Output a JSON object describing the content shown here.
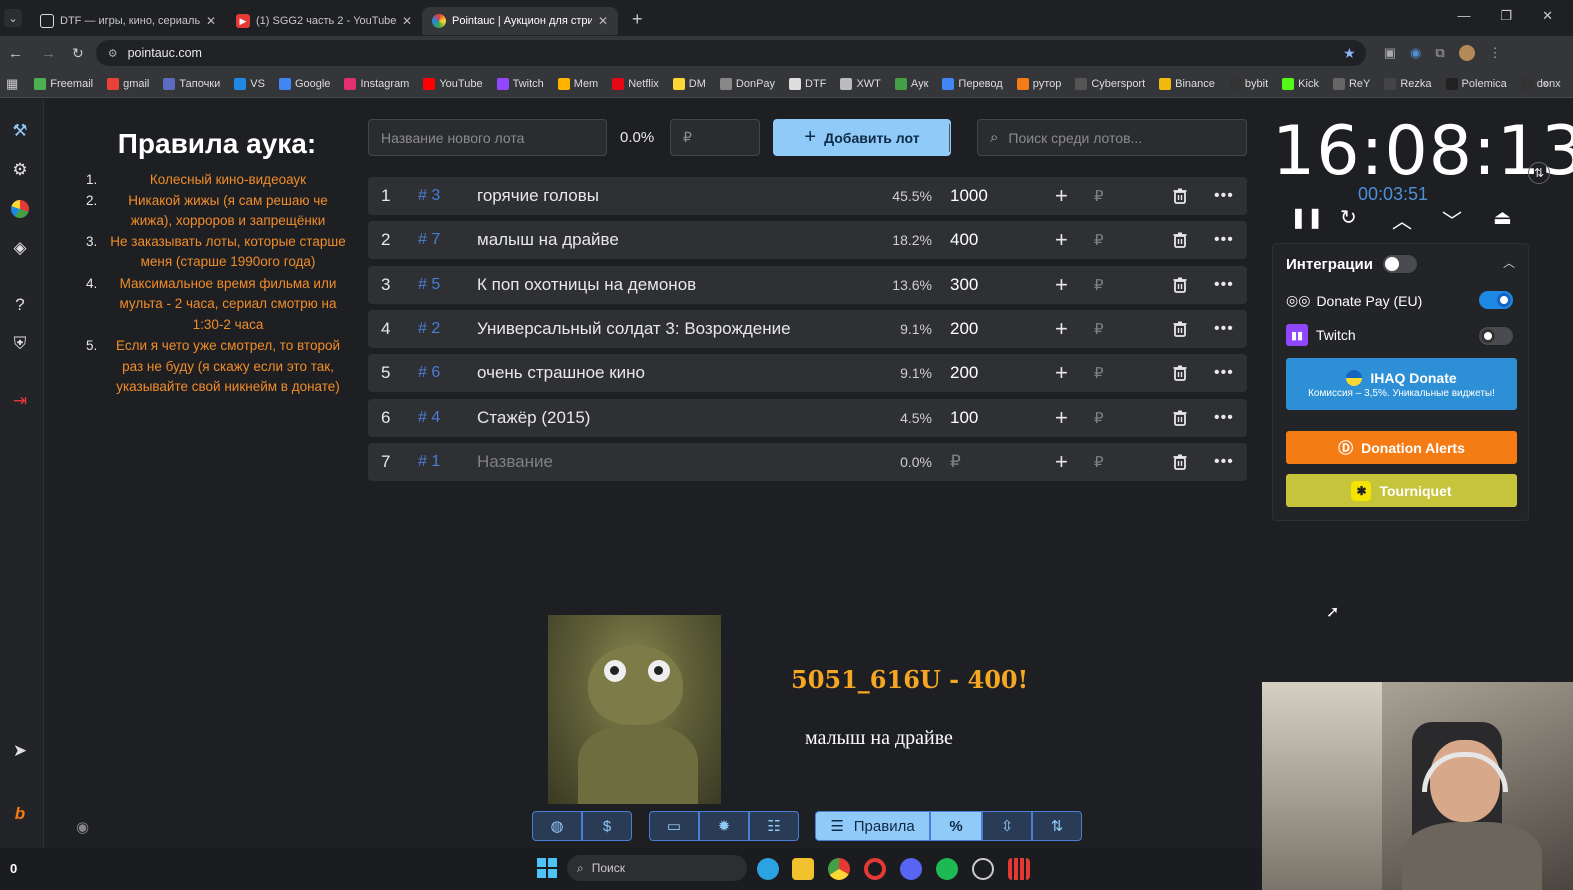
{
  "tabs": [
    {
      "title": "DTF — игры, кино, сериалы, р",
      "icon": "dtf-icon"
    },
    {
      "title": "(1) SGG2 часть 2 - YouTube",
      "icon": "youtube-icon"
    },
    {
      "title": "Pointauc | Аукцион для стриме",
      "icon": "pointauc-icon"
    }
  ],
  "url": "pointauc.com",
  "bookmarks": [
    "Freemail",
    "gmail",
    "Тапочки",
    "VS",
    "Google",
    "Instagram",
    "YouTube",
    "Twitch",
    "Mem",
    "Netflix",
    "DM",
    "DonPay",
    "DTF",
    "XWT",
    "Аук",
    "Перевод",
    "рутор",
    "Cybersport",
    "Binance",
    "bybit",
    "Kick",
    "ReY",
    "Rezka",
    "Polemica",
    "donx"
  ],
  "rules": {
    "title": "Правила аука:",
    "items": [
      {
        "n": "1.",
        "text": "Колесный кино-видеоаук"
      },
      {
        "n": "2.",
        "text": "Никакой жижы (я сам решаю че жижа), хорроров и запрещёнки"
      },
      {
        "n": "3.",
        "text": "Не заказывать лоты, которые старше меня (старше 1990ого года)"
      },
      {
        "n": "4.",
        "text": "Максимальное время фильма или мульта - 2 часа, сериал смотрю на 1:30-2 часа"
      },
      {
        "n": "5.",
        "text": "Если я чето уже смотрел, то второй раз не буду (я скажу если это так, указывайте свой никнейм в донате)"
      }
    ]
  },
  "controls": {
    "new_lot_placeholder": "Название нового лота",
    "percent": "0.0%",
    "amount_placeholder": "₽",
    "add_label": "Добавить лот",
    "search_placeholder": "Поиск среди лотов..."
  },
  "lots": [
    {
      "idx": "1",
      "id": "# 3",
      "name": "горячие головы",
      "pct": "45.5%",
      "amount": "1000"
    },
    {
      "idx": "2",
      "id": "# 7",
      "name": "малыш на драйве",
      "pct": "18.2%",
      "amount": "400"
    },
    {
      "idx": "3",
      "id": "# 5",
      "name": "К поп охотницы на демонов",
      "pct": "13.6%",
      "amount": "300"
    },
    {
      "idx": "4",
      "id": "# 2",
      "name": "Универсальный солдат 3: Возрождение",
      "pct": "9.1%",
      "amount": "200"
    },
    {
      "idx": "5",
      "id": "# 6",
      "name": "очень страшное кино",
      "pct": "9.1%",
      "amount": "200"
    },
    {
      "idx": "6",
      "id": "# 4",
      "name": "Стажёр (2015)",
      "pct": "4.5%",
      "amount": "100"
    },
    {
      "idx": "7",
      "id": "# 1",
      "name": "Название",
      "pct": "0.0%",
      "amount": "₽"
    }
  ],
  "rub": "₽",
  "timer": {
    "main": "16:08:13",
    "sub": "00:03:51"
  },
  "integrations": {
    "title": "Интеграции",
    "donatepay": "Donate Pay (EU)",
    "twitch": "Twitch",
    "ihaq_title": "IHAQ Donate",
    "ihaq_sub": "Комиссия – 3,5%. Уникальные виджеты!",
    "donation_alerts": "Donation Alerts",
    "tourniquet": "Tourniquet",
    "colors": {
      "ihaq": "#2d8fd5",
      "alerts": "#f57c14",
      "tourniquet": "#c6c43a",
      "toggle_on": "#1e88e5"
    }
  },
  "winner": {
    "name": "5051_616U - 400!",
    "lot": "малыш на драйве"
  },
  "bottom_bar": {
    "rules_label": "Правила",
    "percent_symbol": "%",
    "dollar_symbol": "$"
  },
  "taskbar": {
    "search_label": "Поиск",
    "counter": "0"
  }
}
